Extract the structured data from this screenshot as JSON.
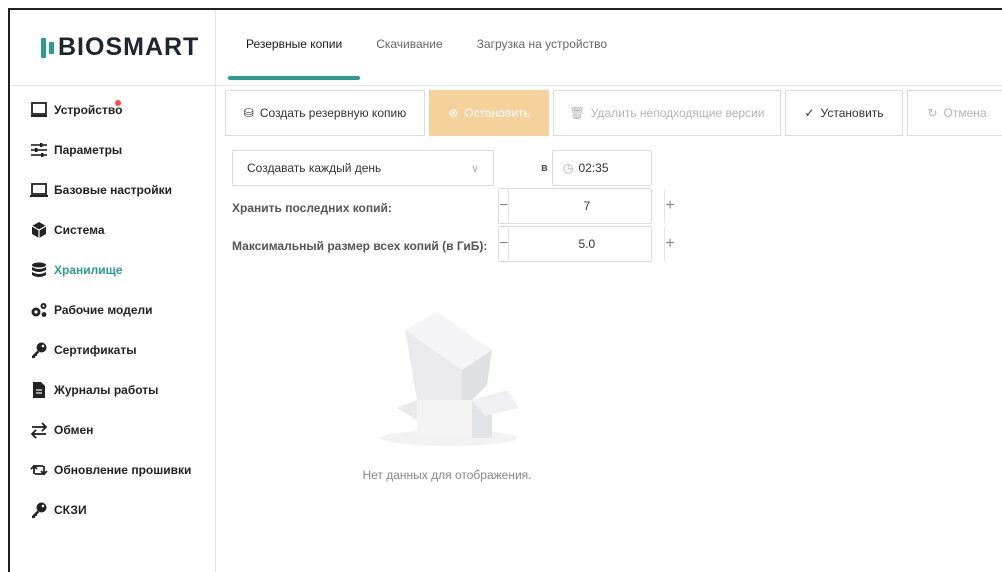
{
  "logo": {
    "text": "BIOSMART"
  },
  "sidebar": {
    "items": [
      {
        "label": "Устройство",
        "icon": "laptop-icon",
        "has_notification": true
      },
      {
        "label": "Параметры",
        "icon": "sliders-icon"
      },
      {
        "label": "Базовые настройки",
        "icon": "laptop-icon"
      },
      {
        "label": "Система",
        "icon": "cube-icon"
      },
      {
        "label": "Хранилище",
        "icon": "database-icon",
        "active": true
      },
      {
        "label": "Рабочие модели",
        "icon": "gears-icon"
      },
      {
        "label": "Сертификаты",
        "icon": "key-icon"
      },
      {
        "label": "Журналы работы",
        "icon": "document-icon"
      },
      {
        "label": "Обмен",
        "icon": "swap-icon"
      },
      {
        "label": "Обновление прошивки",
        "icon": "retweet-icon"
      },
      {
        "label": "СКЗИ",
        "icon": "key-icon"
      }
    ]
  },
  "tabs": [
    {
      "label": "Резервные копии",
      "active": true
    },
    {
      "label": "Скачивание"
    },
    {
      "label": "Загрузка на устройство"
    }
  ],
  "toolbar": {
    "create_label": "Создать резервную копию",
    "stop_label": "Остановить",
    "delete_label": "Удалить неподходящие версии",
    "install_label": "Установить",
    "cancel_label": "Отмена"
  },
  "schedule": {
    "frequency": "Создавать каждый день",
    "at_label": "в",
    "time": "02:35"
  },
  "keep_copies": {
    "label": "Хранить последних копий:",
    "value": "7"
  },
  "max_size": {
    "label": "Максимальный размер всех копий (в ГиБ):",
    "value": "5.0"
  },
  "empty_state": {
    "text": "Нет данных для отображения."
  },
  "colors": {
    "accent": "#2a9d8f",
    "warning": "#f5d19c",
    "notification": "#ff4d4f"
  }
}
